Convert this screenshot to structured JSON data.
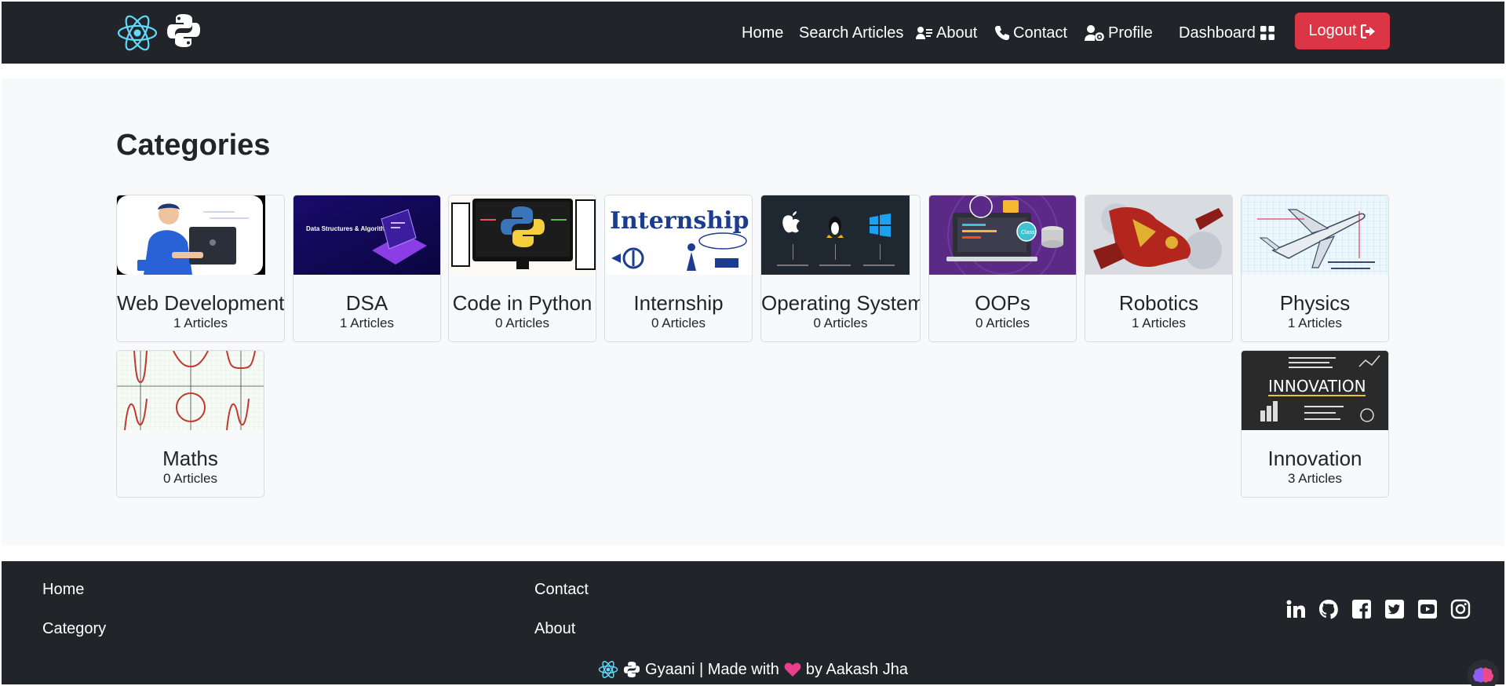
{
  "nav": {
    "links": [
      {
        "label": "Home"
      },
      {
        "label": "Search Articles"
      },
      {
        "label": "About"
      },
      {
        "label": "Contact"
      },
      {
        "label": "Profile"
      },
      {
        "label": "Dashboard"
      }
    ],
    "logout_label": "Logout"
  },
  "main": {
    "title": "Categories",
    "categories": [
      {
        "name": "Web Development",
        "count": "1 Articles",
        "thumb_icon": "web-dev-illustration"
      },
      {
        "name": "DSA",
        "count": "1 Articles",
        "thumb_icon": "dsa-laptop-illustration",
        "thumb_text": "Data Structures & Algorithms"
      },
      {
        "name": "Code in Python",
        "count": "0 Articles",
        "thumb_icon": "python-monitor-illustration"
      },
      {
        "name": "Internship",
        "count": "0 Articles",
        "thumb_icon": "internship-sketch",
        "thumb_text": "Internship"
      },
      {
        "name": "Operating System",
        "count": "0 Articles",
        "thumb_icon": "os-logos"
      },
      {
        "name": "OOPs",
        "count": "0 Articles",
        "thumb_icon": "oops-laptop-illustration",
        "thumb_text": "Class"
      },
      {
        "name": "Robotics",
        "count": "1 Articles",
        "thumb_icon": "robot-illustration"
      },
      {
        "name": "Physics",
        "count": "1 Articles",
        "thumb_icon": "airplane-sketch"
      },
      {
        "name": "Maths",
        "count": "0 Articles",
        "thumb_icon": "graphs-sketch"
      },
      {
        "name": "Innovation",
        "count": "3 Articles",
        "thumb_icon": "chalkboard-innovation",
        "thumb_text": "INNOVATION"
      }
    ]
  },
  "footer": {
    "links": [
      {
        "label": "Home"
      },
      {
        "label": "Contact"
      },
      {
        "label": "Category"
      },
      {
        "label": "About"
      }
    ],
    "social_icons": [
      "linkedin-icon",
      "github-icon",
      "facebook-icon",
      "twitter-icon",
      "youtube-icon",
      "instagram-icon"
    ],
    "credit_prefix": "Gyaani | Made with",
    "credit_suffix": "by Aakash Jha"
  },
  "colors": {
    "navbar_bg": "#212529",
    "logout_bg": "#dc3545",
    "main_bg": "#f8f9fa",
    "react_blue": "#61dafb",
    "heart": "#e83e8c"
  }
}
